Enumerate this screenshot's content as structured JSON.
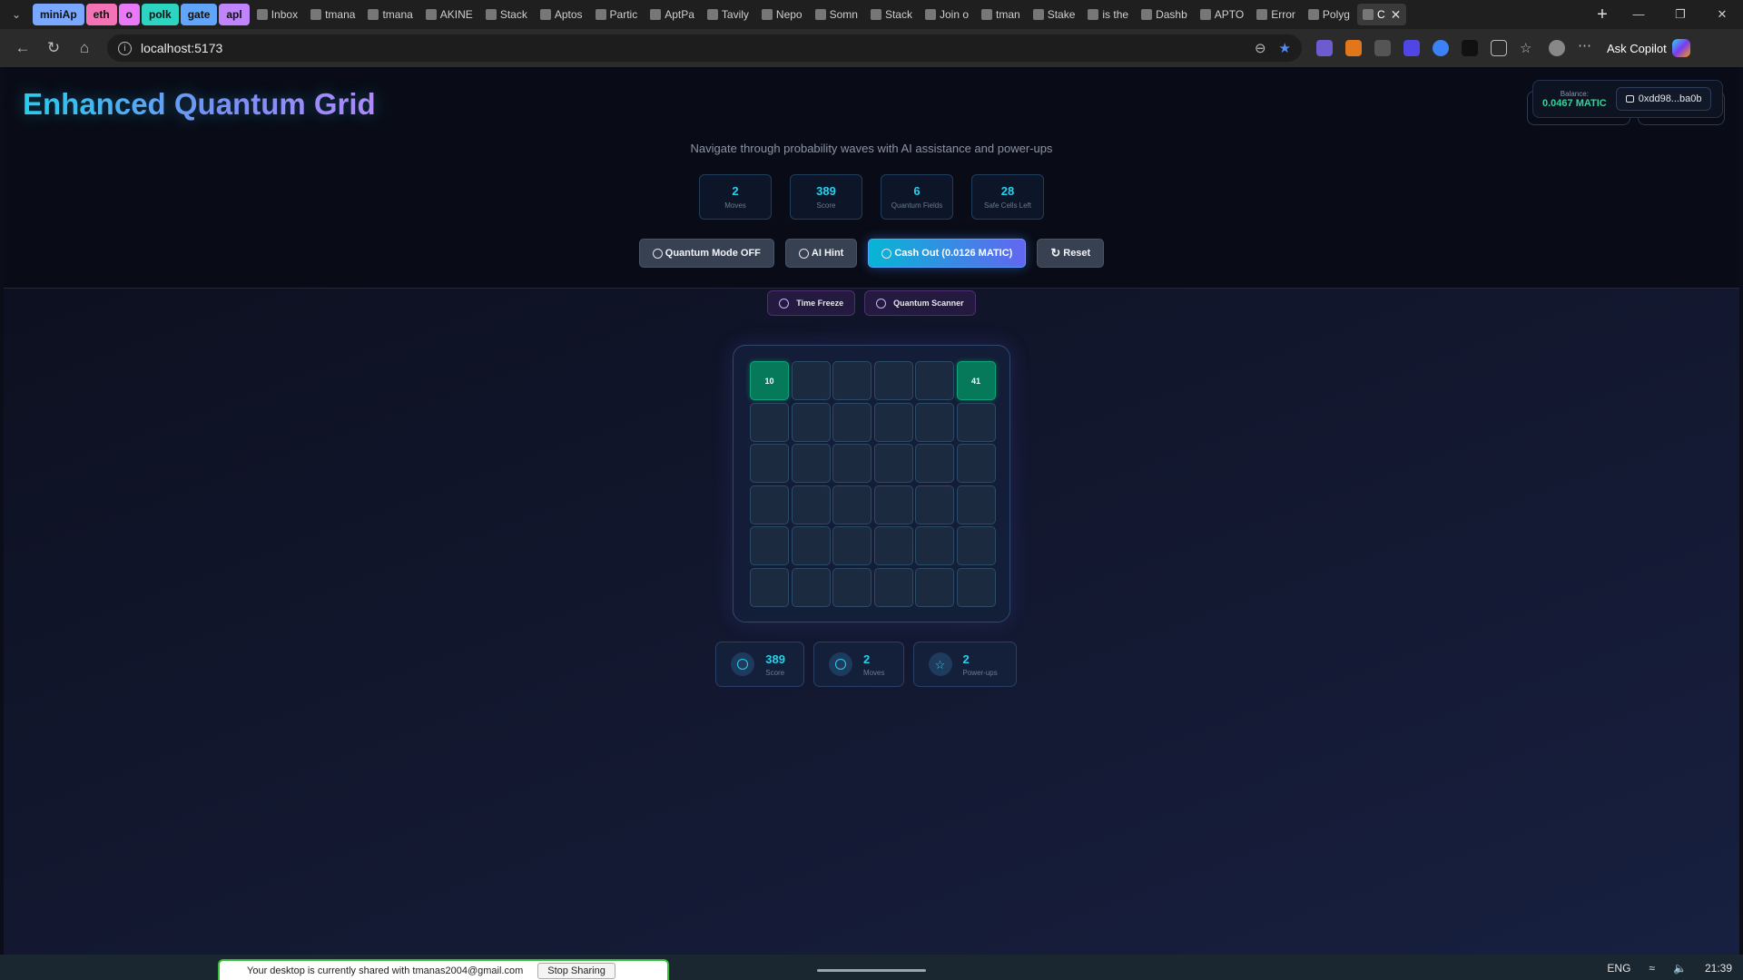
{
  "browser": {
    "tabs": [
      {
        "label": "miniAp",
        "kind": "group",
        "color": "#7aa7ff"
      },
      {
        "label": "eth",
        "kind": "group",
        "color": "#f472b6"
      },
      {
        "label": "o",
        "kind": "group",
        "color": "#e879f9"
      },
      {
        "label": "polk",
        "kind": "group",
        "color": "#2dd4bf"
      },
      {
        "label": "gate",
        "kind": "group",
        "color": "#60a5fa"
      },
      {
        "label": "apl",
        "kind": "group",
        "color": "#c084fc"
      },
      {
        "label": "Inbox",
        "kind": "tab"
      },
      {
        "label": "tmana",
        "kind": "tab"
      },
      {
        "label": "tmana",
        "kind": "tab"
      },
      {
        "label": "AKINE",
        "kind": "tab"
      },
      {
        "label": "Stack",
        "kind": "tab"
      },
      {
        "label": "Aptos",
        "kind": "tab"
      },
      {
        "label": "Partic",
        "kind": "tab"
      },
      {
        "label": "AptPa",
        "kind": "tab"
      },
      {
        "label": "Tavily",
        "kind": "tab"
      },
      {
        "label": "Nepo",
        "kind": "tab"
      },
      {
        "label": "Somn",
        "kind": "tab"
      },
      {
        "label": "Stack",
        "kind": "tab"
      },
      {
        "label": "Join o",
        "kind": "tab"
      },
      {
        "label": "tman",
        "kind": "tab"
      },
      {
        "label": "Stake",
        "kind": "tab"
      },
      {
        "label": "is the",
        "kind": "tab"
      },
      {
        "label": "Dashb",
        "kind": "tab"
      },
      {
        "label": "APTO",
        "kind": "tab"
      },
      {
        "label": "Error",
        "kind": "tab"
      },
      {
        "label": "Polyg",
        "kind": "tab"
      },
      {
        "label": "C",
        "kind": "active"
      }
    ],
    "url": "localhost:5173",
    "copilot_label": "Ask Copilot"
  },
  "app": {
    "title": "Enhanced Quantum Grid",
    "subtitle": "Navigate through probability waves with AI assistance and power-ups",
    "wallet": {
      "balance_label": "Balance:",
      "balance_value": "0.0467 MATIC",
      "address": "0xdd98...ba0b"
    },
    "stats": [
      {
        "value": "2",
        "label": "Moves"
      },
      {
        "value": "389",
        "label": "Score"
      },
      {
        "value": "6",
        "label": "Quantum Fields"
      },
      {
        "value": "28",
        "label": "Safe Cells Left"
      }
    ],
    "actions": {
      "quantum_mode": "Quantum Mode OFF",
      "ai_hint": "AI Hint",
      "cash_out": "Cash Out (0.0126 MATIC)",
      "reset": "Reset"
    },
    "powerups": {
      "time_freeze": "Time Freeze",
      "quantum_scanner": "Quantum Scanner"
    },
    "grid": {
      "size": 6,
      "revealed": [
        {
          "index": 0,
          "value": "10"
        },
        {
          "index": 5,
          "value": "41"
        }
      ]
    },
    "bottom_stats": [
      {
        "value": "389",
        "label": "Score",
        "icon": "target-icon"
      },
      {
        "value": "2",
        "label": "Moves",
        "icon": "clock-icon"
      },
      {
        "value": "2",
        "label": "Power-ups",
        "icon": "star-icon"
      }
    ]
  },
  "os": {
    "share_text": "Your desktop is currently shared with tmanas2004@gmail.com",
    "stop_sharing": "Stop Sharing",
    "lang": "ENG",
    "time": "21:39"
  }
}
